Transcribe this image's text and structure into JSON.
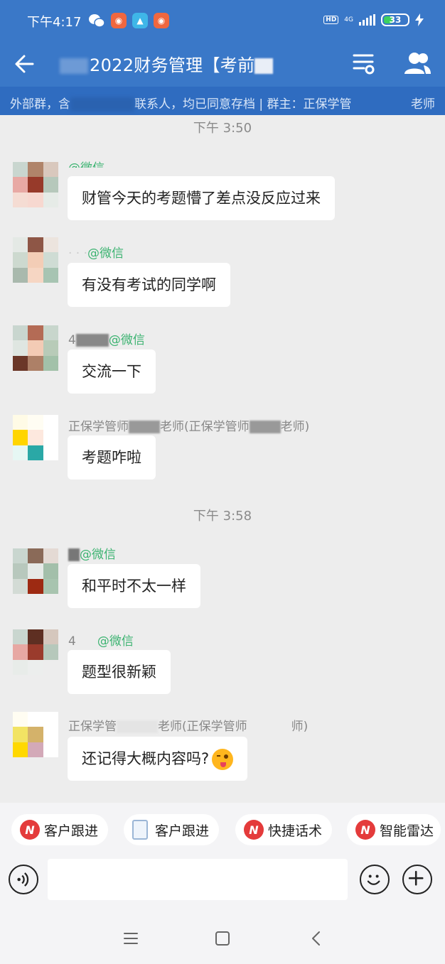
{
  "status_bar": {
    "time": "下午4:17",
    "net": "4G",
    "hd": "HD",
    "battery": "33"
  },
  "header": {
    "title": "2022财务管理【考前",
    "notice_left": "外部群，含",
    "notice_mid": "联系人，均已同意存档 | 群主：正保学管",
    "notice_right": "老师"
  },
  "messages": [
    {
      "type": "time",
      "text": "下午 3:50"
    },
    {
      "type": "msg",
      "sender_suffix": "@微信",
      "text": "财管今天的考题懵了差点没反应过来"
    },
    {
      "type": "msg",
      "sender_suffix": "@微信",
      "text": "有没有考试的同学啊"
    },
    {
      "type": "msg",
      "sender_prefix": "4",
      "sender_suffix": "@微信",
      "text": "交流一下"
    },
    {
      "type": "msg",
      "sender_prefix": "正保学管师",
      "sender_mid": "老师(正保学管师",
      "sender_suffix": "老师)",
      "text": "考题咋啦"
    },
    {
      "type": "time",
      "text": "下午 3:58"
    },
    {
      "type": "msg",
      "sender_suffix": "@微信",
      "text": "和平时不太一样"
    },
    {
      "type": "msg",
      "sender_prefix": "4",
      "sender_suffix": "@微信",
      "text": "题型很新颖"
    },
    {
      "type": "msg",
      "sender_prefix": "正保学管",
      "sender_mid": "老师(正保学管师",
      "sender_suffix": "师)",
      "text": "还记得大概内容吗?"
    }
  ],
  "quick_actions": [
    {
      "icon": "radar-n-icon",
      "label": "客户跟进"
    },
    {
      "icon": "document-icon",
      "label": "客户跟进"
    },
    {
      "icon": "radar-n-icon",
      "label": "快捷话术"
    },
    {
      "icon": "radar-n-icon",
      "label": "智能雷达"
    }
  ],
  "input": {
    "placeholder": ""
  },
  "colors": {
    "brand": "#3a78c8",
    "notice": "#2f6cc0",
    "wechat_green": "#3cb371"
  }
}
